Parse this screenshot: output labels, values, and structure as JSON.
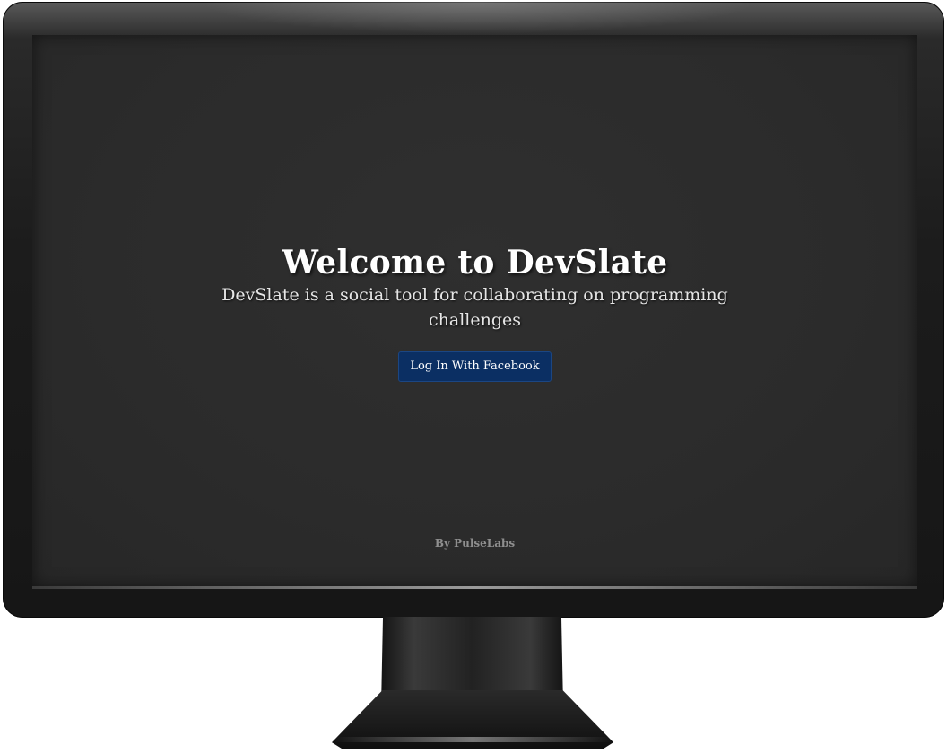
{
  "landing": {
    "title": "Welcome to DevSlate",
    "subtitle": "DevSlate is a social tool for collaborating on programming challenges",
    "login_button_label": "Log In With Facebook",
    "footer_text": "By PulseLabs"
  },
  "colors": {
    "screen_background": "#2b2b2b",
    "title_text": "#ffffff",
    "button_background": "#0b2f63",
    "footer_text": "#8f8f8f"
  }
}
